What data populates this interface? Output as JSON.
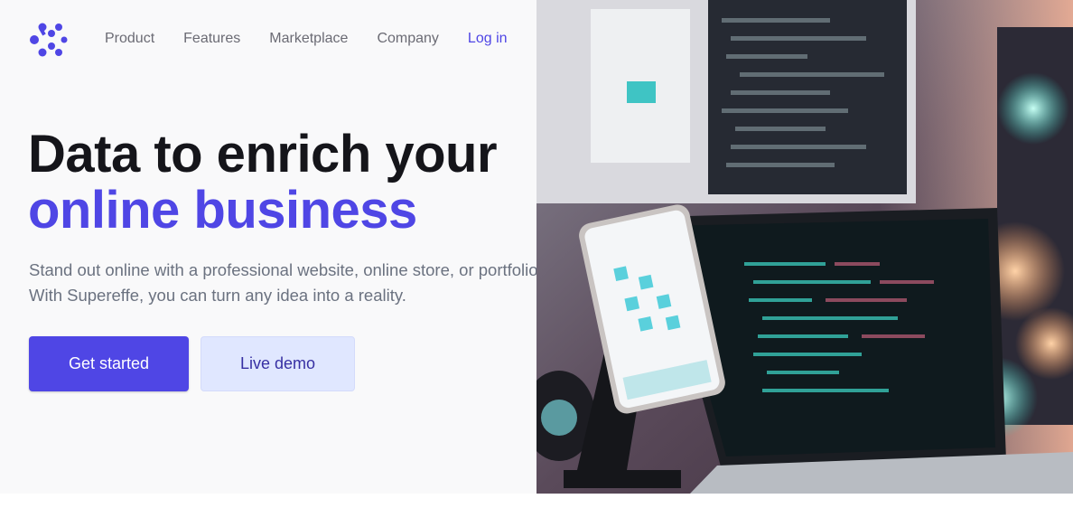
{
  "logo": {
    "icon": "brand-logo-icon",
    "color": "#4f46e5"
  },
  "nav": {
    "items": [
      {
        "label": "Product"
      },
      {
        "label": "Features"
      },
      {
        "label": "Marketplace"
      },
      {
        "label": "Company"
      }
    ],
    "login_label": "Log in"
  },
  "hero": {
    "headline_line1": "Data to enrich your",
    "headline_line2": "online business",
    "subtext": "Stand out online with a professional website, online store, or portfolio. With Supereffe, you can turn any idea into a reality.",
    "primary_button": "Get started",
    "secondary_button": "Live demo"
  },
  "image": {
    "subject": "workspace-photo-phone-laptop-code"
  },
  "colors": {
    "accent": "#4f46e5",
    "heading": "#15151a",
    "body": "#6b7280",
    "secondary_bg": "#e0e7ff"
  }
}
